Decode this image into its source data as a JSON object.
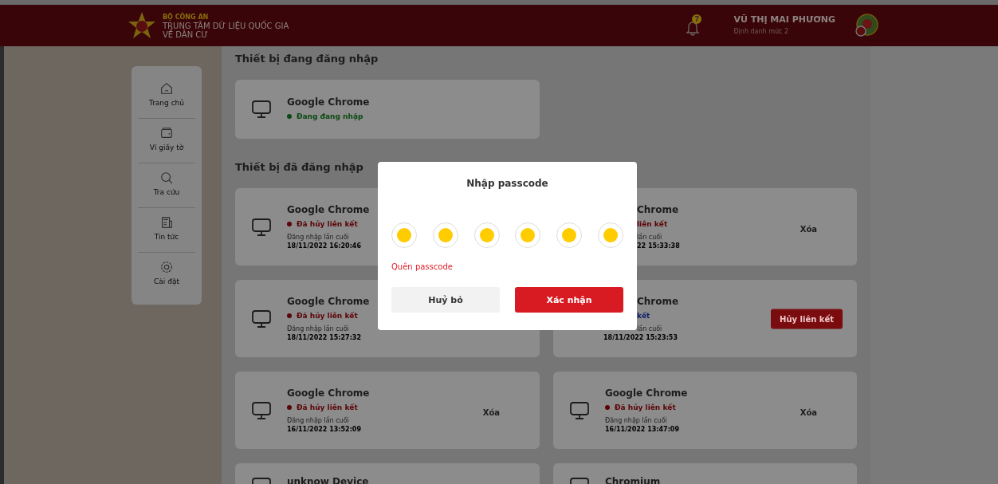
{
  "header": {
    "agency": "BỘ CÔNG AN",
    "org_line_1": "TRUNG TÂM DỮ LIỆU QUỐC GIA",
    "org_line_2": "VỀ DÂN CƯ",
    "notification_count": "7",
    "user_name": "VŨ THỊ MAI PHƯƠNG",
    "user_level": "Định danh mức 2"
  },
  "sidebar": {
    "items": [
      {
        "label": "Trang chủ"
      },
      {
        "label": "Ví giấy tờ"
      },
      {
        "label": "Tra cứu"
      },
      {
        "label": "Tin tức"
      },
      {
        "label": "Cài đặt"
      }
    ]
  },
  "current_section": {
    "title": "Thiết bị đang đăng nhập",
    "devices": [
      {
        "kind": "full",
        "name": "Google Chrome",
        "status": {
          "text": "Đang đang nhập",
          "color": "#0b4a12"
        }
      }
    ]
  },
  "past_section": {
    "title": "Thiết bị đã đăng nhập",
    "devices": [
      {
        "kind": "full",
        "name": "Google Chrome",
        "status": {
          "text": "Đã hủy liên kết",
          "color": "#5c0306"
        },
        "last_label": "Đăng nhập lần cuối",
        "last_time": "18/11/2022 16:20:46"
      },
      {
        "kind": "covered",
        "name": "Chrome",
        "status": {
          "text": "liên kết",
          "color": "#5c0306"
        },
        "last_label": "lần cuối",
        "last_time": "22 15:33:38",
        "time_cut": true,
        "action": {
          "kind": "link",
          "label": "Xóa"
        }
      },
      {
        "kind": "full",
        "name": "Google Chrome",
        "status": {
          "text": "Đã hủy liên kết",
          "color": "#5c0306"
        },
        "last_label": "Đăng nhập lần cuối",
        "last_time": "18/11/2022 15:27:32"
      },
      {
        "kind": "covered",
        "name": "Chrome",
        "status": {
          "text": "kết",
          "color": "#0e1e66"
        },
        "last_label": "lần cuối",
        "last_time": "18/11/2022 15:23:53",
        "time_cut": false,
        "action": {
          "kind": "button",
          "label": "Hủy liên kết"
        }
      },
      {
        "kind": "full",
        "name": "Google Chrome",
        "status": {
          "text": "Đã hủy liên kết",
          "color": "#5c0306"
        },
        "last_label": "Đăng nhập lần cuối",
        "last_time": "16/11/2022 13:52:09",
        "action": {
          "kind": "link",
          "label": "Xóa"
        }
      },
      {
        "kind": "full",
        "name": "Google Chrome",
        "status": {
          "text": "Đã hủy liên kết",
          "color": "#5c0306"
        },
        "last_label": "Đăng nhập lần cuối",
        "last_time": "16/11/2022 13:47:09",
        "action": {
          "kind": "link",
          "label": "Xóa"
        }
      },
      {
        "kind": "full",
        "name": "unknow Device"
      },
      {
        "kind": "full",
        "name": "Chromium"
      }
    ]
  },
  "dialog": {
    "title": "Nhập passcode",
    "digits": [
      {
        "filled": true
      },
      {
        "filled": true
      },
      {
        "filled": true
      },
      {
        "filled": true
      },
      {
        "filled": true
      },
      {
        "filled": true
      }
    ],
    "forgot_link": "Quên passcode",
    "cancel_button": "Huỷ bỏ",
    "confirm_button": "Xác nhận"
  }
}
